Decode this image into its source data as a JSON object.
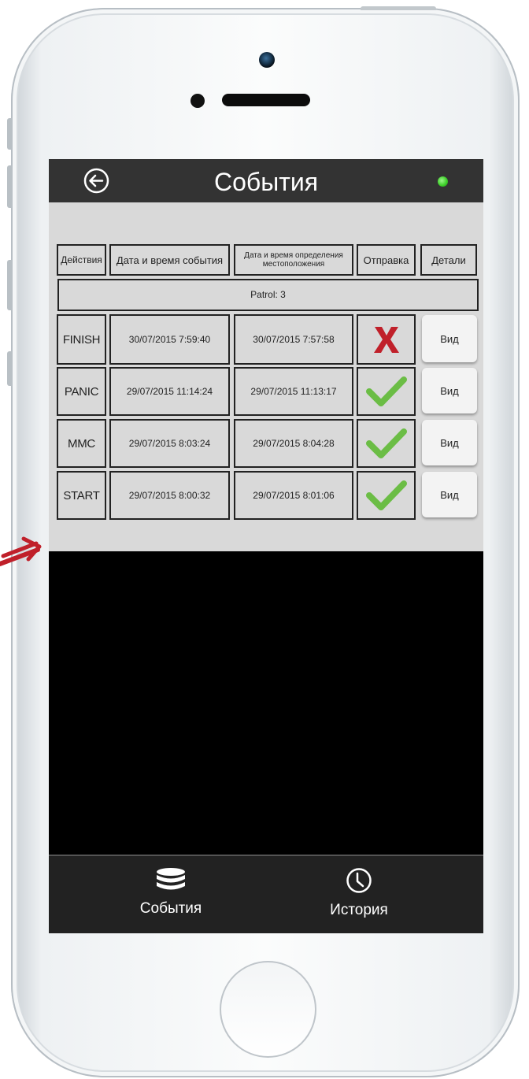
{
  "header": {
    "title": "События",
    "back_icon": "back-arrow-icon",
    "status_color": "#3fd12b"
  },
  "table": {
    "headers": {
      "actions": "Действия",
      "event_time": "Дата и время события",
      "location_time": "Дата и время определения местоположения",
      "sending": "Отправка",
      "details": "Детали"
    },
    "group_label": "Patrol: 3",
    "rows": [
      {
        "action": "FINISH",
        "event_time": "30/07/2015 7:59:40",
        "location_time": "30/07/2015 7:57:58",
        "status": "failed",
        "status_icon": "x-icon",
        "view": "Вид"
      },
      {
        "action": "PANIC",
        "event_time": "29/07/2015 11:14:24",
        "location_time": "29/07/2015 11:13:17",
        "status": "sent",
        "status_icon": "check-icon",
        "view": "Вид"
      },
      {
        "action": "MMC",
        "event_time": "29/07/2015 8:03:24",
        "location_time": "29/07/2015 8:04:28",
        "status": "sent",
        "status_icon": "check-icon",
        "view": "Вид"
      },
      {
        "action": "START",
        "event_time": "29/07/2015 8:00:32",
        "location_time": "29/07/2015 8:01:06",
        "status": "sent",
        "status_icon": "check-icon",
        "view": "Вид"
      }
    ]
  },
  "tabbar": {
    "events_label": "События",
    "events_icon": "database-stack-icon",
    "history_label": "История",
    "history_icon": "clock-icon"
  },
  "colors": {
    "check": "#6bbd45",
    "cross": "#c0202a",
    "annotation": "#c0202a",
    "header_bg": "#333333",
    "content_bg": "#d9d9d9"
  }
}
